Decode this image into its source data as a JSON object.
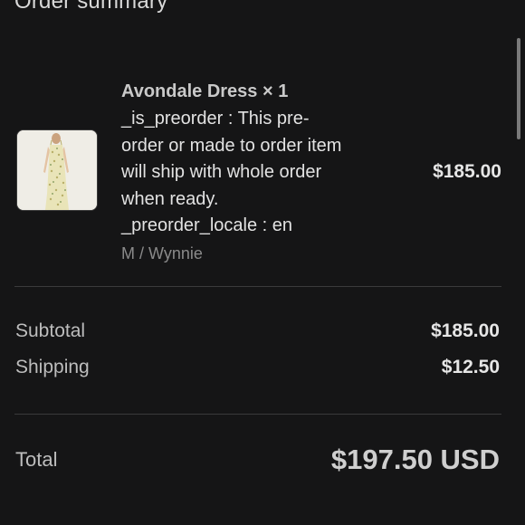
{
  "header": {
    "title": "Order summary"
  },
  "item": {
    "title": "Avondale Dress × 1",
    "properties": [
      "_is_preorder : This pre-",
      "order or made to order item",
      "will ship with whole order",
      "when ready.",
      "_preorder_locale : en"
    ],
    "variant": "M / Wynnie",
    "price": "$185.00",
    "thumbnail_icon": "dress-product-image"
  },
  "summary": {
    "subtotal_label": "Subtotal",
    "subtotal_value": "$185.00",
    "shipping_label": "Shipping",
    "shipping_value": "$12.50"
  },
  "total": {
    "label": "Total",
    "value": "$197.50 USD"
  },
  "colors": {
    "background": "#151516",
    "divider": "#3a3a3b",
    "text_primary": "#e6e6e6",
    "text_muted": "#8a8a8a"
  }
}
